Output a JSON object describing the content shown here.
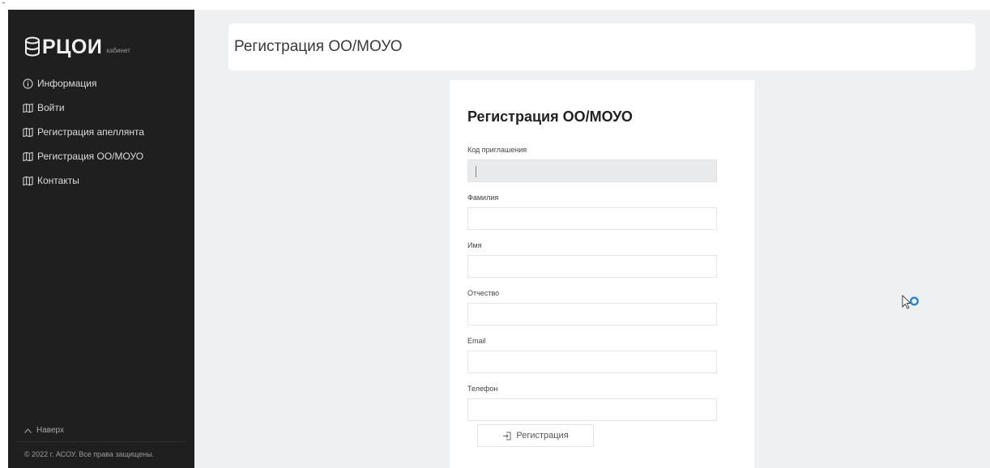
{
  "sidebar": {
    "brand": {
      "name": "РЦОИ",
      "subtitle": "кабинет"
    },
    "items": [
      {
        "label": "Информация",
        "icon": "info-icon"
      },
      {
        "label": "Войти",
        "icon": "map-icon"
      },
      {
        "label": "Регистрация апеллянта",
        "icon": "map-icon"
      },
      {
        "label": "Регистрация ОО/МОУО",
        "icon": "map-icon"
      },
      {
        "label": "Контакты",
        "icon": "map-icon"
      }
    ],
    "back_to_top": "Наверх",
    "copyright": "© 2022 г. АСОУ. Все права защищены."
  },
  "header": {
    "title": "Регистрация ОО/МОУО"
  },
  "form": {
    "title": "Регистрация ОО/МОУО",
    "fields": [
      {
        "label": "Код приглашения",
        "value": "",
        "disabled": true
      },
      {
        "label": "Фамилия",
        "value": ""
      },
      {
        "label": "Имя",
        "value": ""
      },
      {
        "label": "Отчество",
        "value": ""
      },
      {
        "label": "Email",
        "value": ""
      },
      {
        "label": "Телефон",
        "value": ""
      }
    ],
    "submit_label": "Регистрация"
  },
  "colors": {
    "sidebar_bg": "#1f1f1f",
    "main_bg": "#eef0f2",
    "card_bg": "#ffffff",
    "spinner": "#1e88e5"
  }
}
